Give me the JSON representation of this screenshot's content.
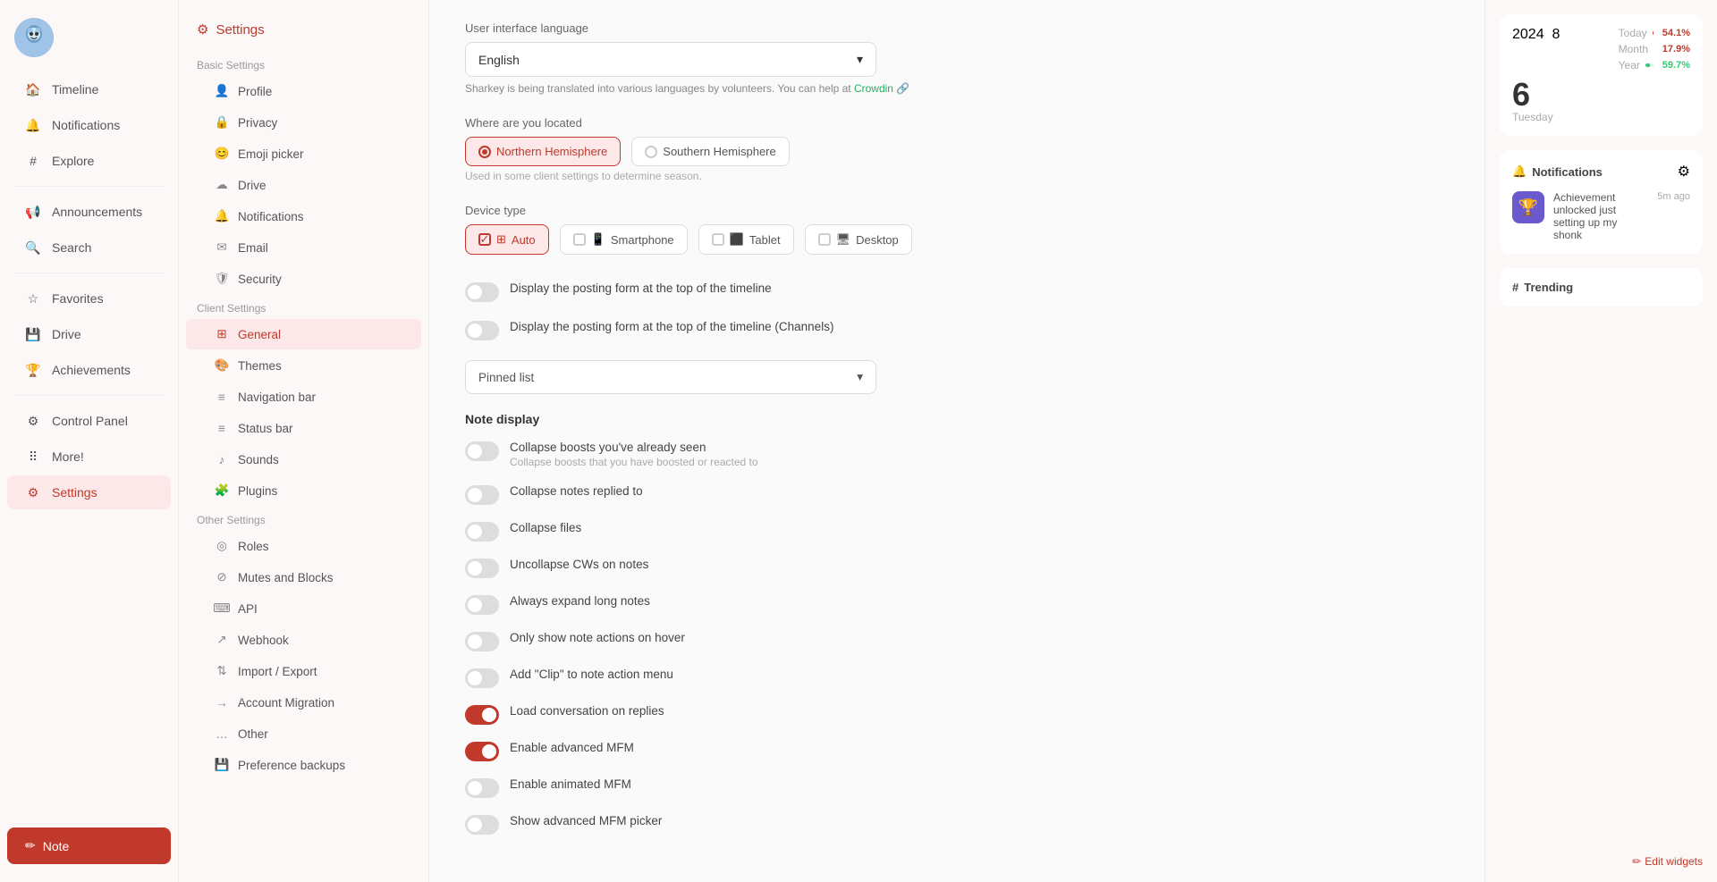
{
  "app": {
    "title": "Settings"
  },
  "sidebar": {
    "nav_items": [
      {
        "id": "timeline",
        "label": "Timeline",
        "icon": "home"
      },
      {
        "id": "notifications",
        "label": "Notifications",
        "icon": "bell"
      },
      {
        "id": "explore",
        "label": "Explore",
        "icon": "hash"
      },
      {
        "id": "announcements",
        "label": "Announcements",
        "icon": "megaphone"
      },
      {
        "id": "search",
        "label": "Search",
        "icon": "search"
      },
      {
        "id": "favorites",
        "label": "Favorites",
        "icon": "star"
      },
      {
        "id": "drive",
        "label": "Drive",
        "icon": "drive"
      },
      {
        "id": "achievements",
        "label": "Achievements",
        "icon": "trophy"
      },
      {
        "id": "control_panel",
        "label": "Control Panel",
        "icon": "control"
      },
      {
        "id": "more",
        "label": "More!",
        "icon": "grid"
      },
      {
        "id": "settings",
        "label": "Settings",
        "icon": "gear",
        "active": true
      }
    ],
    "note_button": "Note"
  },
  "settings_panel": {
    "header": "Settings",
    "sections": [
      {
        "title": "Basic Settings",
        "items": [
          {
            "id": "profile",
            "label": "Profile",
            "icon": "person"
          },
          {
            "id": "privacy",
            "label": "Privacy",
            "icon": "lock"
          },
          {
            "id": "emoji_picker",
            "label": "Emoji picker",
            "icon": "emoji"
          },
          {
            "id": "drive",
            "label": "Drive",
            "icon": "cloud"
          },
          {
            "id": "notifications",
            "label": "Notifications",
            "icon": "bell"
          },
          {
            "id": "email",
            "label": "Email",
            "icon": "email"
          },
          {
            "id": "security",
            "label": "Security",
            "icon": "shield"
          }
        ]
      },
      {
        "title": "Client Settings",
        "items": [
          {
            "id": "general",
            "label": "General",
            "icon": "sliders",
            "active": true
          },
          {
            "id": "themes",
            "label": "Themes",
            "icon": "palette"
          },
          {
            "id": "navigation_bar",
            "label": "Navigation bar",
            "icon": "menu"
          },
          {
            "id": "status_bar",
            "label": "Status bar",
            "icon": "menu"
          },
          {
            "id": "sounds",
            "label": "Sounds",
            "icon": "music"
          },
          {
            "id": "plugins",
            "label": "Plugins",
            "icon": "puzzle"
          }
        ]
      },
      {
        "title": "Other Settings",
        "items": [
          {
            "id": "roles",
            "label": "Roles",
            "icon": "roles"
          },
          {
            "id": "mutes_blocks",
            "label": "Mutes and Blocks",
            "icon": "block"
          },
          {
            "id": "api",
            "label": "API",
            "icon": "api"
          },
          {
            "id": "webhook",
            "label": "Webhook",
            "icon": "webhook"
          },
          {
            "id": "import_export",
            "label": "Import / Export",
            "icon": "import"
          },
          {
            "id": "account_migration",
            "label": "Account Migration",
            "icon": "migrate"
          },
          {
            "id": "other",
            "label": "Other",
            "icon": "dots"
          }
        ]
      },
      {
        "title": "",
        "items": [
          {
            "id": "preference_backups",
            "label": "Preference backups",
            "icon": "backup"
          }
        ]
      }
    ]
  },
  "content": {
    "language": {
      "label": "User interface language",
      "value": "English",
      "dropdown_icon": "chevron-down"
    },
    "translate_note": "Sharkey is being translated into various languages by volunteers. You can help at",
    "translate_link": "Crowdin",
    "location": {
      "label": "Where are you located",
      "options": [
        {
          "id": "northern",
          "label": "Northern Hemisphere",
          "selected": true
        },
        {
          "id": "southern",
          "label": "Southern Hemisphere",
          "selected": false
        }
      ],
      "hint": "Used in some client settings to determine season."
    },
    "device_type": {
      "label": "Device type",
      "options": [
        {
          "id": "auto",
          "label": "Auto",
          "selected": true
        },
        {
          "id": "smartphone",
          "label": "Smartphone",
          "selected": false
        },
        {
          "id": "tablet",
          "label": "Tablet",
          "selected": false
        },
        {
          "id": "desktop",
          "label": "Desktop",
          "selected": false
        }
      ]
    },
    "timeline_options": [
      {
        "id": "posting_form_top",
        "label": "Display the posting form at the top of the timeline",
        "enabled": false
      },
      {
        "id": "posting_form_channels",
        "label": "Display the posting form at the top of the timeline (Channels)",
        "enabled": false
      }
    ],
    "pinned_list": {
      "label": "Pinned list",
      "value": "Pinned list"
    },
    "note_display": {
      "title": "Note display",
      "options": [
        {
          "id": "collapse_boosts",
          "label": "Collapse boosts you've already seen",
          "sublabel": "Collapse boosts that you have boosted or reacted to",
          "enabled": false
        },
        {
          "id": "collapse_notes_replied",
          "label": "Collapse notes replied to",
          "sublabel": "",
          "enabled": false
        },
        {
          "id": "collapse_files",
          "label": "Collapse files",
          "sublabel": "",
          "enabled": false
        },
        {
          "id": "uncollapse_cws",
          "label": "Uncollapse CWs on notes",
          "sublabel": "",
          "enabled": false
        },
        {
          "id": "always_expand_long",
          "label": "Always expand long notes",
          "sublabel": "",
          "enabled": false
        },
        {
          "id": "only_show_note_actions_hover",
          "label": "Only show note actions on hover",
          "sublabel": "",
          "enabled": false
        },
        {
          "id": "add_clip_menu",
          "label": "Add \"Clip\" to note action menu",
          "sublabel": "",
          "enabled": false
        },
        {
          "id": "load_conversation_replies",
          "label": "Load conversation on replies",
          "sublabel": "",
          "enabled": true
        },
        {
          "id": "enable_advanced_mfm",
          "label": "Enable advanced MFM",
          "sublabel": "",
          "enabled": true
        },
        {
          "id": "enable_animated_mfm",
          "label": "Enable animated MFM",
          "sublabel": "",
          "enabled": false
        },
        {
          "id": "show_advanced_mfm_picker",
          "label": "Show advanced MFM picker",
          "sublabel": "",
          "enabled": false
        }
      ]
    }
  },
  "right_sidebar": {
    "stats": {
      "year": "2024",
      "month": "8",
      "day": "6",
      "weekday": "Tuesday",
      "metrics": [
        {
          "label": "Today",
          "value": "54.1%",
          "fill": 54
        },
        {
          "label": "Month",
          "value": "17.9%",
          "fill": 18
        },
        {
          "label": "Year",
          "value": "59.7%",
          "fill": 60
        }
      ]
    },
    "notifications": {
      "title": "Notifications",
      "items": [
        {
          "id": "notif1",
          "text": "Achievement unlocked just setting up my shonk",
          "time": "5m ago",
          "avatar_emoji": "🏆"
        }
      ]
    },
    "trending": {
      "title": "Trending"
    },
    "edit_widgets_label": "Edit widgets"
  }
}
